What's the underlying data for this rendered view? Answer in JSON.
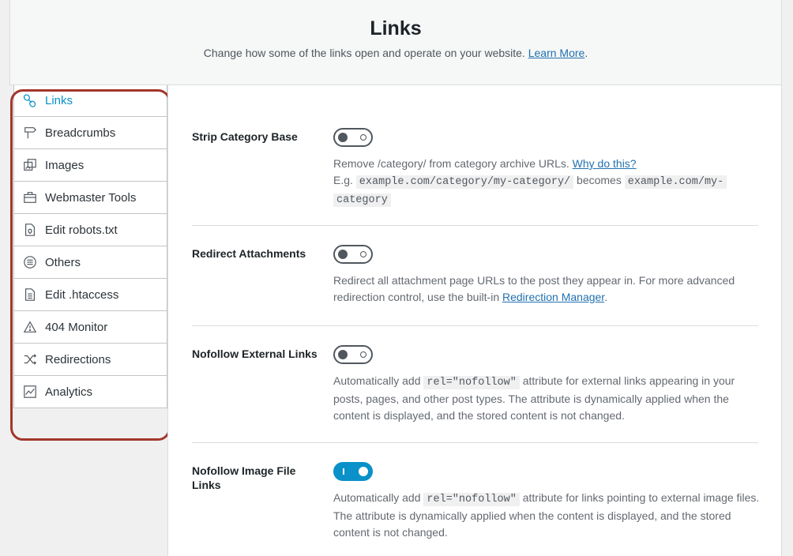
{
  "header": {
    "title": "Links",
    "subtitle": "Change how some of the links open and operate on your website.",
    "learn_more": "Learn More",
    "period": "."
  },
  "nav": {
    "items": [
      {
        "label": "Links",
        "icon": "link-icon"
      },
      {
        "label": "Breadcrumbs",
        "icon": "signpost-icon"
      },
      {
        "label": "Images",
        "icon": "images-icon"
      },
      {
        "label": "Webmaster Tools",
        "icon": "toolbox-icon"
      },
      {
        "label": "Edit robots.txt",
        "icon": "robots-file-icon"
      },
      {
        "label": "Others",
        "icon": "list-circle-icon"
      },
      {
        "label": "Edit .htaccess",
        "icon": "htaccess-file-icon"
      },
      {
        "label": "404 Monitor",
        "icon": "warning-icon"
      },
      {
        "label": "Redirections",
        "icon": "shuffle-icon"
      },
      {
        "label": "Analytics",
        "icon": "chart-icon"
      }
    ],
    "active": "Links"
  },
  "settings": {
    "strip": {
      "label": "Strip Category Base",
      "enabled": false,
      "desc1": "Remove /category/ from category archive URLs.",
      "why": "Why do this?",
      "eg": "E.g.",
      "code1": "example.com/category/my-category/",
      "becomes": "becomes",
      "code2a": "example.com/my-",
      "code2b": "category"
    },
    "redirect": {
      "label": "Redirect Attachments",
      "enabled": false,
      "desc": "Redirect all attachment page URLs to the post they appear in. For more advanced redirection control, use the built-in",
      "link": "Redirection Manager",
      "period": "."
    },
    "nofollow_ext": {
      "label": "Nofollow External Links",
      "enabled": false,
      "pre": "Automatically add",
      "code": "rel=\"nofollow\"",
      "post": "attribute for external links appearing in your posts, pages, and other post types. The attribute is dynamically applied when the content is displayed, and the stored content is not changed."
    },
    "nofollow_img": {
      "label": "Nofollow Image File Links",
      "enabled": true,
      "pre": "Automatically add",
      "code": "rel=\"nofollow\"",
      "post": "attribute for links pointing to external image files. The attribute is dynamically applied when the content is displayed, and the stored content is not changed."
    }
  },
  "colors": {
    "accent": "#0a91c9",
    "link": "#2271b1",
    "highlight": "#a3362b"
  }
}
